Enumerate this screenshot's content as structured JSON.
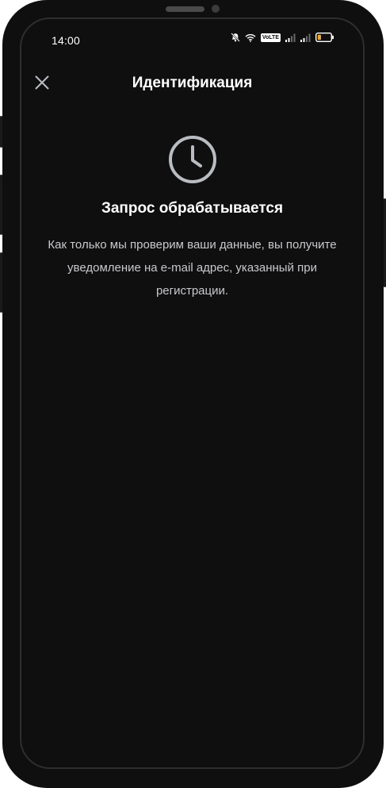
{
  "status_bar": {
    "time": "14:00",
    "volte_label": "VoLTE",
    "icons": [
      "bell-muted-icon",
      "wifi-icon",
      "volte-icon",
      "signal-icon",
      "signal-icon",
      "battery-icon"
    ],
    "battery_color": "#f5a623"
  },
  "header": {
    "title": "Идентификация",
    "close_icon": "close-icon"
  },
  "main": {
    "icon": "clock-icon",
    "heading": "Запрос обрабатывается",
    "description": "Как только мы проверим ваши данные, вы получите уведомление на e-mail адрес, указанный при регистрации."
  },
  "colors": {
    "background": "#0f0f10",
    "text_primary": "#ffffff",
    "text_secondary": "#c9c9cc",
    "icon_gray": "#b9bcc1"
  }
}
